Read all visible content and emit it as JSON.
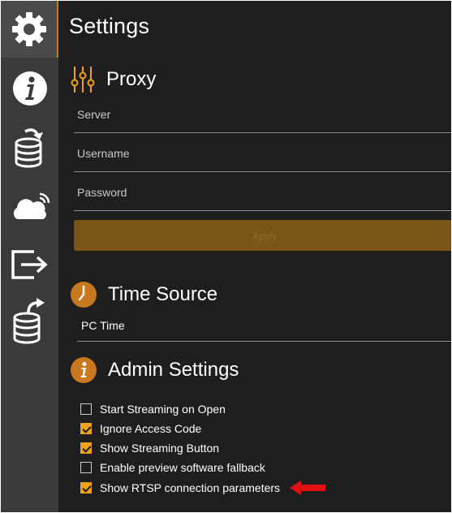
{
  "window": {
    "title": "Settings"
  },
  "sidebar": {
    "items": [
      {
        "icon": "gear-icon",
        "active": true
      },
      {
        "icon": "info-icon",
        "active": false
      },
      {
        "icon": "database-import-icon",
        "active": false
      },
      {
        "icon": "cloud-wifi-icon",
        "active": false
      },
      {
        "icon": "exit-icon",
        "active": false
      },
      {
        "icon": "database-export-icon",
        "active": false
      }
    ]
  },
  "proxy": {
    "title": "Proxy",
    "icon": "sliders-icon",
    "server_placeholder": "Server",
    "username_placeholder": "Username",
    "password_placeholder": "Password",
    "apply_label": "Apply"
  },
  "time_source": {
    "title": "Time Source",
    "icon": "clock-icon",
    "value": "PC Time"
  },
  "admin": {
    "title": "Admin Settings",
    "icon": "info-circle-icon",
    "options": [
      {
        "label": "Start Streaming on Open",
        "checked": false
      },
      {
        "label": "Ignore Access Code",
        "checked": true
      },
      {
        "label": "Show Streaming Button",
        "checked": true
      },
      {
        "label": "Enable preview software fallback",
        "checked": false
      },
      {
        "label": "Show RTSP connection parameters",
        "checked": true
      }
    ]
  },
  "colors": {
    "accent": "#F2A01F",
    "background": "#1E1E1E",
    "sidebar": "#3A3A3A",
    "annotation_arrow": "#E01010"
  }
}
